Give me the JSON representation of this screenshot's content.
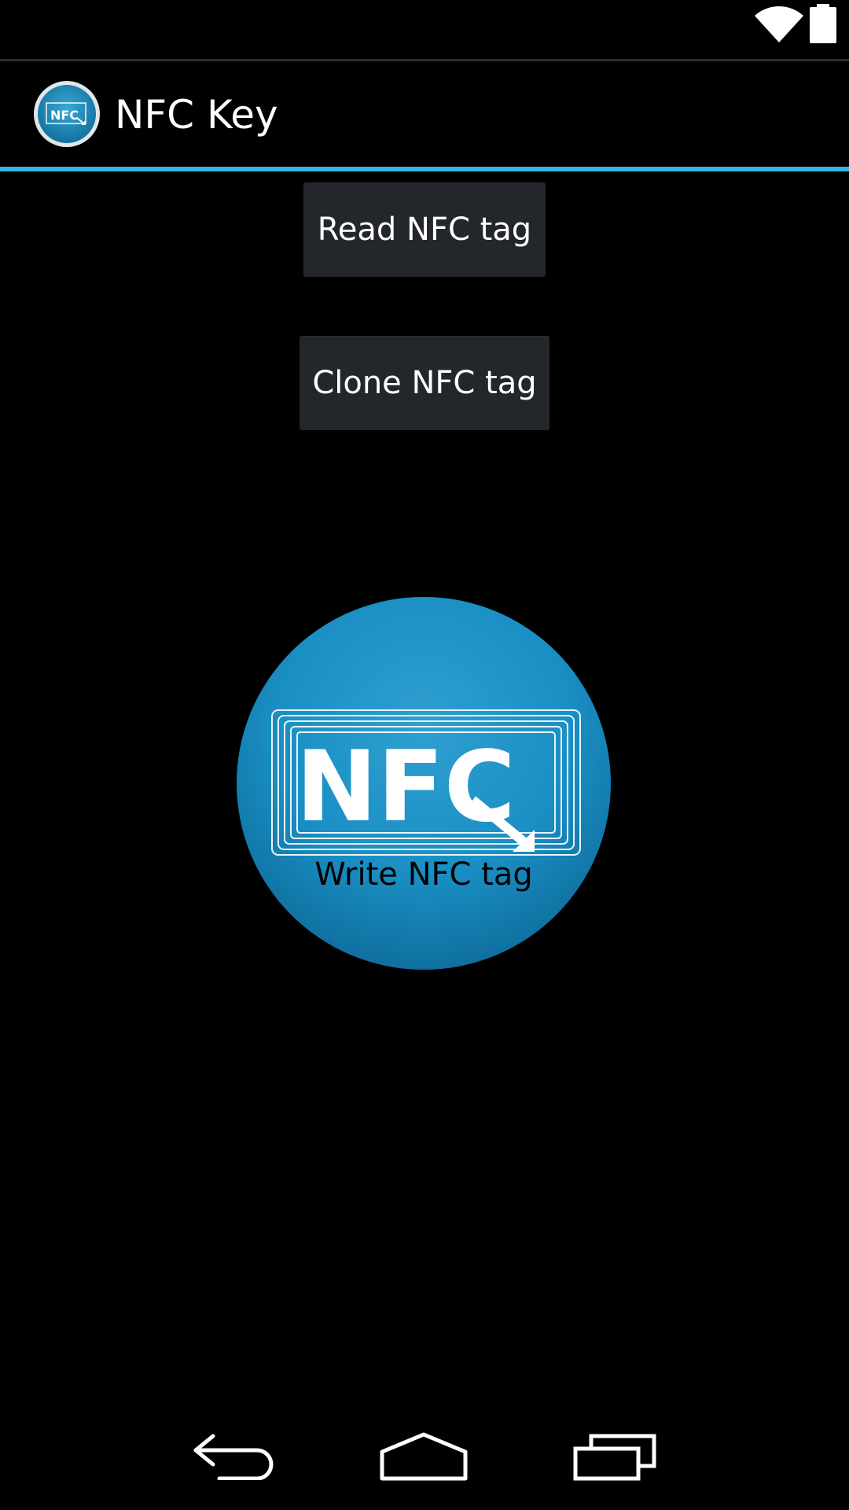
{
  "status_bar": {
    "icons": [
      "wifi-icon",
      "battery-icon"
    ]
  },
  "action_bar": {
    "app_icon": "nfc-logo-icon",
    "title": "NFC Key",
    "accent_color": "#33b5e5"
  },
  "main": {
    "read_button_label": "Read NFC tag",
    "clone_button_label": "Clone NFC tag",
    "write_button_label": "Write NFC tag",
    "write_button_logo_text": "NFC"
  },
  "nav_bar": {
    "icons": [
      "back-icon",
      "home-icon",
      "recent-apps-icon"
    ]
  },
  "colors": {
    "background": "#000000",
    "button_bg": "#23272b",
    "logo_blue": "#1a8fc4"
  }
}
